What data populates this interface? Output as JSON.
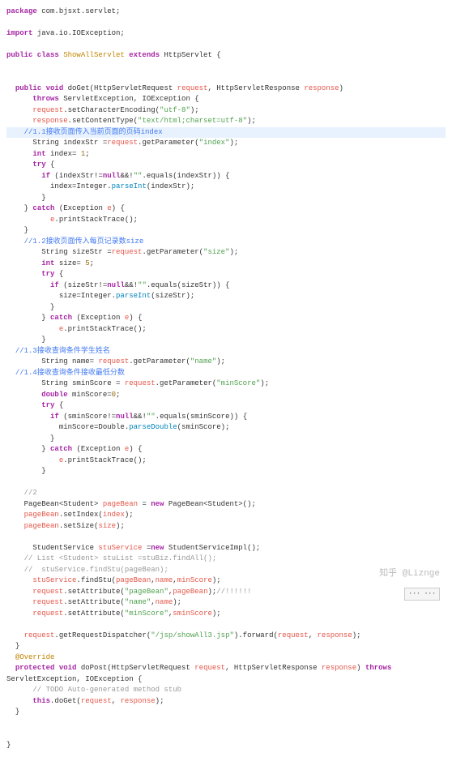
{
  "code": {
    "l1a": "package",
    "l1b": " com.bjsxt.servlet;",
    "l2a": "import",
    "l2b": " java.io.IOException;",
    "l3a": "public class",
    "l3b": " ShowAllServlet ",
    "l3c": "extends",
    "l3d": " HttpServlet {",
    "l4a": "  public void",
    "l4b": " doGet(HttpServletRequest ",
    "l4c": "request",
    "l4d": ", HttpServletResponse ",
    "l4e": "response",
    "l4f": ")",
    "l5a": "      throws",
    "l5b": " ServletException, IOException {",
    "l6a": "      request",
    "l6b": ".setCharacterEncoding(",
    "l6c": "\"utf-8\"",
    "l6d": ");",
    "l7a": "      response",
    "l7b": ".setContentType(",
    "l7c": "\"text/html;charset=utf-8\"",
    "l7d": ");",
    "l8": "    //1.1接收页面传入当前页面的页码index",
    "l9a": "      String indexStr =",
    "l9b": "request",
    "l9c": ".getParameter(",
    "l9d": "\"index\"",
    "l9e": ");",
    "l10a": "      int",
    "l10b": " index= ",
    "l10c": "1",
    "l10d": ";",
    "l11a": "      try",
    "l11b": " {",
    "l12a": "        if",
    "l12b": " (indexStr!=",
    "l12c": "null",
    "l12d": "&&!",
    "l12e": "\"\"",
    "l12f": ".equals(indexStr)) {",
    "l13a": "          index=Integer.",
    "l13b": "parseInt",
    "l13c": "(indexStr);",
    "l14": "        }",
    "l15a": "    } ",
    "l15b": "catch",
    "l15c": " (Exception ",
    "l15d": "e",
    "l15e": ") {",
    "l16a": "          e",
    "l16b": ".printStackTrace();",
    "l17": "    }",
    "l18": "    //1.2接收页面传入每页记录数size",
    "l19a": "        String sizeStr =",
    "l19b": "request",
    "l19c": ".getParameter(",
    "l19d": "\"size\"",
    "l19e": ");",
    "l20a": "        int",
    "l20b": " size= ",
    "l20c": "5",
    "l20d": ";",
    "l21a": "        try",
    "l21b": " {",
    "l22a": "          if",
    "l22b": " (sizeStr!=",
    "l22c": "null",
    "l22d": "&&!",
    "l22e": "\"\"",
    "l22f": ".equals(sizeStr)) {",
    "l23a": "            size=Integer.",
    "l23b": "parseInt",
    "l23c": "(sizeStr);",
    "l24": "          }",
    "l25a": "        } ",
    "l25b": "catch",
    "l25c": " (Exception ",
    "l25d": "e",
    "l25e": ") {",
    "l26a": "            e",
    "l26b": ".printStackTrace();",
    "l27": "        }",
    "l28": "  //1.3接收查询条件学生姓名",
    "l29a": "        String name= ",
    "l29b": "request",
    "l29c": ".getParameter(",
    "l29d": "\"name\"",
    "l29e": ");",
    "l30": "  //1.4接收查询条件接收最低分数",
    "l31a": "        String sminScore = ",
    "l31b": "request",
    "l31c": ".getParameter(",
    "l31d": "\"minScore\"",
    "l31e": ");",
    "l32a": "        double",
    "l32b": " minScore=",
    "l32c": "0",
    "l32d": ";",
    "l33a": "        try",
    "l33b": " {",
    "l34a": "          if",
    "l34b": " (sminScore!=",
    "l34c": "null",
    "l34d": "&&!",
    "l34e": "\"\"",
    "l34f": ".equals(sminScore)) {",
    "l35a": "            minScore=Double.",
    "l35b": "parseDouble",
    "l35c": "(sminScore);",
    "l36": "          }",
    "l37a": "        } ",
    "l37b": "catch",
    "l37c": " (Exception ",
    "l37d": "e",
    "l37e": ") {",
    "l38a": "            e",
    "l38b": ".printStackTrace();",
    "l39": "        }",
    "l41": "    //2",
    "l42a": "    PageBean<Student> ",
    "l42b": "pageBean",
    "l42c": " = ",
    "l42d": "new",
    "l42e": " PageBean<Student>();",
    "l43a": "    pageBean",
    "l43b": ".setIndex(",
    "l43c": "index",
    "l43d": ");",
    "l44a": "    pageBean",
    "l44b": ".setSize(",
    "l44c": "size",
    "l44d": ");",
    "l46a": "      StudentService ",
    "l46b": "stuService",
    "l46c": " =",
    "l46d": "new",
    "l46e": " StudentServiceImpl();",
    "l47": "    // List <Student> stuList =stuBiz.findAll();",
    "l48": "    //  stuService.findStu(pageBean);",
    "l49a": "      stuService",
    "l49b": ".findStu(",
    "l49c": "pageBean",
    "l49d": ",",
    "l49e": "name",
    "l49f": ",",
    "l49g": "minScore",
    "l49h": ");",
    "l50a": "      request",
    "l50b": ".setAttribute(",
    "l50c": "\"pageBean\"",
    "l50d": ",",
    "l50e": "pageBean",
    "l50f": ");",
    "l50g": "//!!!!!!",
    "l51a": "      request",
    "l51b": ".setAttribute(",
    "l51c": "\"name\"",
    "l51d": ",",
    "l51e": "name",
    "l51f": ");",
    "l52a": "      request",
    "l52b": ".setAttribute(",
    "l52c": "\"minScore\"",
    "l52d": ",",
    "l52e": "sminScore",
    "l52f": ");",
    "l54a": "    request",
    "l54b": ".getRequestDispatcher(",
    "l54c": "\"/jsp/showAll3.jsp\"",
    "l54d": ").forward(",
    "l54e": "request",
    "l54f": ", ",
    "l54g": "response",
    "l54h": ");",
    "l55": "  }",
    "l56": "  @Override",
    "l57a": "  protected void",
    "l57b": " doPost(HttpServletRequest ",
    "l57c": "request",
    "l57d": ", HttpServletResponse ",
    "l57e": "response",
    "l57f": ") ",
    "l57g": "throws",
    "l57h": " ServletException, IOException {",
    "l58": "      // TODO Auto-generated method stub",
    "l59a": "      this",
    "l59b": ".doGet(",
    "l59c": "request",
    "l59d": ", ",
    "l59e": "response",
    "l59f": ");",
    "l60": "  }",
    "l62": "}"
  },
  "watermark": "知乎 @Liznge",
  "btn": "··· ···"
}
